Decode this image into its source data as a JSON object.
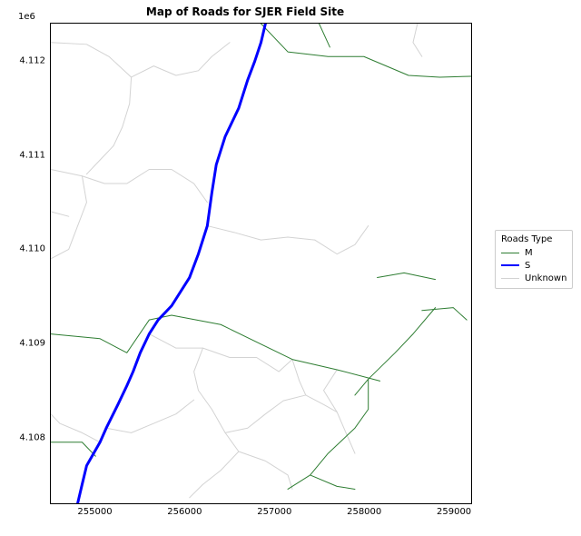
{
  "title": "Map of Roads for SJER Field Site",
  "y_exponent": "1e6",
  "x_ticks": [
    "255000",
    "256000",
    "257000",
    "258000",
    "259000"
  ],
  "y_ticks": [
    "4.108",
    "4.109",
    "4.110",
    "4.111",
    "4.112"
  ],
  "legend": {
    "title": "Roads Type",
    "items": [
      {
        "label": "M"
      },
      {
        "label": "S"
      },
      {
        "label": "Unknown"
      }
    ]
  },
  "chart_data": {
    "type": "map",
    "title": "Map of Roads for SJER Field Site",
    "xlabel": "",
    "ylabel": "",
    "xlim": [
      254500,
      259200
    ],
    "ylim": [
      4107300,
      4112400
    ],
    "series": [
      {
        "name": "M",
        "color": "#2e7d32",
        "linewidth": 1,
        "segments": [
          [
            [
              254500,
              4109100
            ],
            [
              255050,
              4109050
            ],
            [
              255350,
              4108900
            ],
            [
              255600,
              4109250
            ],
            [
              255850,
              4109300
            ],
            [
              256400,
              4109200
            ],
            [
              257200,
              4108830
            ],
            [
              257700,
              4108720
            ],
            [
              258180,
              4108600
            ]
          ],
          [
            [
              254500,
              4107950
            ],
            [
              254850,
              4107950
            ],
            [
              255000,
              4107800
            ]
          ],
          [
            [
              256850,
              4112400
            ],
            [
              257150,
              4112100
            ],
            [
              257600,
              4112050
            ],
            [
              258000,
              4112050
            ],
            [
              258500,
              4111850
            ],
            [
              258850,
              4111830
            ],
            [
              259200,
              4111840
            ]
          ],
          [
            [
              257500,
              4112400
            ],
            [
              257620,
              4112150
            ]
          ],
          [
            [
              258150,
              4109700
            ],
            [
              258450,
              4109750
            ],
            [
              258800,
              4109680
            ]
          ],
          [
            [
              258650,
              4109350
            ],
            [
              259000,
              4109380
            ],
            [
              259150,
              4109250
            ]
          ],
          [
            [
              257900,
              4108450
            ],
            [
              258050,
              4108620
            ],
            [
              258350,
              4108900
            ],
            [
              258550,
              4109100
            ],
            [
              258800,
              4109380
            ]
          ],
          [
            [
              257150,
              4107450
            ],
            [
              257400,
              4107600
            ],
            [
              257700,
              4107480
            ],
            [
              257900,
              4107450
            ]
          ],
          [
            [
              257400,
              4107600
            ],
            [
              257600,
              4107830
            ],
            [
              257900,
              4108100
            ],
            [
              258050,
              4108300
            ],
            [
              258050,
              4108620
            ]
          ]
        ]
      },
      {
        "name": "S",
        "color": "#0000ff",
        "linewidth": 3,
        "segments": [
          [
            [
              254800,
              4107300
            ],
            [
              254850,
              4107500
            ],
            [
              254900,
              4107700
            ],
            [
              255050,
              4107950
            ],
            [
              255120,
              4108100
            ],
            [
              255250,
              4108350
            ],
            [
              255350,
              4108550
            ],
            [
              255420,
              4108700
            ],
            [
              255500,
              4108900
            ],
            [
              255600,
              4109100
            ],
            [
              255700,
              4109250
            ],
            [
              255850,
              4109400
            ],
            [
              256050,
              4109700
            ],
            [
              256150,
              4109950
            ],
            [
              256250,
              4110250
            ],
            [
              256300,
              4110600
            ],
            [
              256350,
              4110900
            ],
            [
              256450,
              4111200
            ],
            [
              256600,
              4111500
            ],
            [
              256700,
              4111800
            ],
            [
              256780,
              4112000
            ],
            [
              256850,
              4112200
            ],
            [
              256900,
              4112400
            ]
          ]
        ]
      },
      {
        "name": "Unknown",
        "color": "#d3d3d3",
        "linewidth": 1,
        "segments": [
          [
            [
              254500,
              4112200
            ],
            [
              254900,
              4112180
            ],
            [
              255150,
              4112050
            ],
            [
              255400,
              4111830
            ]
          ],
          [
            [
              255400,
              4111830
            ],
            [
              255650,
              4111950
            ],
            [
              255900,
              4111850
            ],
            [
              256150,
              4111900
            ],
            [
              256300,
              4112050
            ],
            [
              256500,
              4112200
            ]
          ],
          [
            [
              255400,
              4111830
            ],
            [
              255380,
              4111550
            ],
            [
              255300,
              4111300
            ],
            [
              255200,
              4111100
            ]
          ],
          [
            [
              254500,
              4110850
            ],
            [
              254850,
              4110780
            ],
            [
              255100,
              4110700
            ],
            [
              255350,
              4110700
            ],
            [
              255600,
              4110850
            ],
            [
              255850,
              4110850
            ],
            [
              256100,
              4110700
            ],
            [
              256250,
              4110500
            ]
          ],
          [
            [
              254850,
              4110780
            ],
            [
              254900,
              4110500
            ],
            [
              254800,
              4110250
            ],
            [
              254700,
              4110000
            ],
            [
              254500,
              4109900
            ]
          ],
          [
            [
              254500,
              4110400
            ],
            [
              254700,
              4110350
            ]
          ],
          [
            [
              256250,
              4110250
            ],
            [
              256550,
              4110180
            ],
            [
              256850,
              4110100
            ],
            [
              257150,
              4110130
            ],
            [
              257450,
              4110100
            ]
          ],
          [
            [
              255600,
              4109100
            ],
            [
              255900,
              4108950
            ],
            [
              256200,
              4108950
            ],
            [
              256500,
              4108850
            ],
            [
              256800,
              4108850
            ],
            [
              257050,
              4108700
            ],
            [
              257200,
              4108830
            ]
          ],
          [
            [
              256200,
              4108950
            ],
            [
              256100,
              4108700
            ],
            [
              256150,
              4108500
            ],
            [
              256300,
              4108300
            ],
            [
              256450,
              4108050
            ],
            [
              256600,
              4107850
            ]
          ],
          [
            [
              256600,
              4107850
            ],
            [
              256900,
              4107750
            ],
            [
              257150,
              4107600
            ],
            [
              257200,
              4107450
            ]
          ],
          [
            [
              256600,
              4107850
            ],
            [
              256400,
              4107650
            ],
            [
              256200,
              4107500
            ],
            [
              256050,
              4107360
            ]
          ],
          [
            [
              255120,
              4108100
            ],
            [
              255400,
              4108050
            ],
            [
              255650,
              4108150
            ],
            [
              255900,
              4108250
            ],
            [
              256100,
              4108400
            ]
          ],
          [
            [
              255050,
              4107950
            ],
            [
              254850,
              4108050
            ],
            [
              254600,
              4108150
            ],
            [
              254500,
              4108250
            ]
          ],
          [
            [
              256450,
              4108050
            ],
            [
              256700,
              4108100
            ],
            [
              256900,
              4108250
            ],
            [
              257100,
              4108390
            ],
            [
              257350,
              4108450
            ]
          ],
          [
            [
              257200,
              4108830
            ],
            [
              257280,
              4108600
            ],
            [
              257350,
              4108450
            ],
            [
              257550,
              4108350
            ],
            [
              257700,
              4108270
            ]
          ],
          [
            [
              257700,
              4108720
            ],
            [
              257550,
              4108500
            ],
            [
              257700,
              4108270
            ],
            [
              257800,
              4108050
            ],
            [
              257900,
              4107830
            ]
          ],
          [
            [
              257450,
              4110100
            ],
            [
              257700,
              4109950
            ],
            [
              257900,
              4110050
            ],
            [
              258050,
              4110250
            ]
          ],
          [
            [
              258600,
              4112400
            ],
            [
              258550,
              4112200
            ],
            [
              258650,
              4112050
            ]
          ],
          [
            [
              255200,
              4111100
            ],
            [
              255050,
              4110950
            ],
            [
              254900,
              4110800
            ]
          ]
        ]
      }
    ]
  }
}
